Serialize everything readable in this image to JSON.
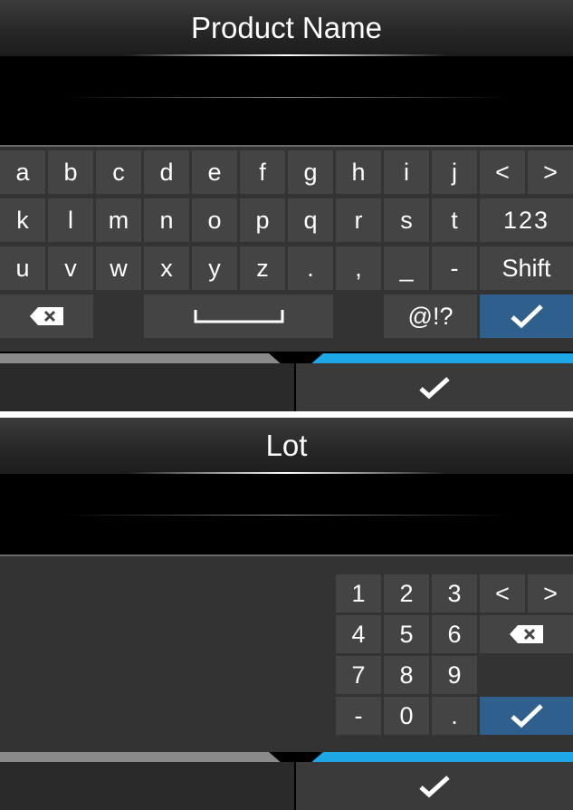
{
  "screen1": {
    "title": "Product Name",
    "rows": [
      [
        "a",
        "b",
        "c",
        "d",
        "e",
        "f",
        "g",
        "h",
        "i",
        "j",
        "<",
        ">"
      ],
      [
        "k",
        "l",
        "m",
        "n",
        "o",
        "p",
        "q",
        "r",
        "s",
        "t",
        "123"
      ],
      [
        "u",
        "v",
        "w",
        "x",
        "y",
        "z",
        ".",
        ",",
        "_",
        "-",
        "Shift"
      ]
    ],
    "symbols_label": "@!?"
  },
  "screen2": {
    "title": "Lot",
    "keys": [
      [
        "1",
        "2",
        "3",
        "<",
        ">"
      ],
      [
        "4",
        "5",
        "6"
      ],
      [
        "7",
        "8",
        "9"
      ],
      [
        "-",
        "0",
        "."
      ]
    ]
  },
  "icons": {
    "backspace": "backspace-icon",
    "enter": "checkmark-icon",
    "space": "space-icon",
    "confirm": "checkmark-icon"
  },
  "colors": {
    "enter_key": "#2e5f8d",
    "progress_active": "#1ea7e6",
    "progress_inactive": "#8a8a8a"
  }
}
